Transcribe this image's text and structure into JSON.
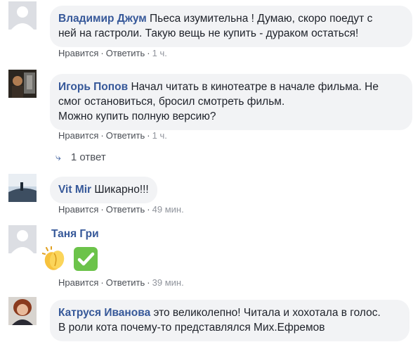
{
  "comments": [
    {
      "author": "Владимир Джум",
      "text_line1": "Пьеса изумительна ! Думаю, скоро поедут с",
      "text_line2": "ней на гастроли. Такую вещь не купить - дураком остаться!",
      "like": "Нравится",
      "reply": "Ответить",
      "time": "1 ч."
    },
    {
      "author": "Игорь Попов",
      "text_line1": "Начал читать в кинотеатре в начале фильма. Не",
      "text_line2": "смог остановиться, бросил смотреть фильм.",
      "text_line3": "Можно купить полную версию?",
      "like": "Нравится",
      "reply": "Ответить",
      "time": "1 ч."
    },
    {
      "author": "Vit Mir",
      "text_line1": "Шикарно!!!",
      "like": "Нравится",
      "reply": "Ответить",
      "time": "49 мин."
    },
    {
      "author": "Таня Гри",
      "emojis": [
        "clapping-hands-icon",
        "check-mark-button-icon"
      ],
      "like": "Нравится",
      "reply": "Ответить",
      "time": "39 мин."
    },
    {
      "author": "Катруся Иванова",
      "text_line1": "это великолепно! Читала и хохотала в голос.",
      "text_line2": "В роли кота почему-то представлялся Мих.Ефремов"
    }
  ],
  "replies_link": {
    "label": "1 ответ"
  },
  "separator": "·",
  "colors": {
    "author": "#365899",
    "bubble": "#f2f3f5",
    "meta": "#90949c"
  }
}
